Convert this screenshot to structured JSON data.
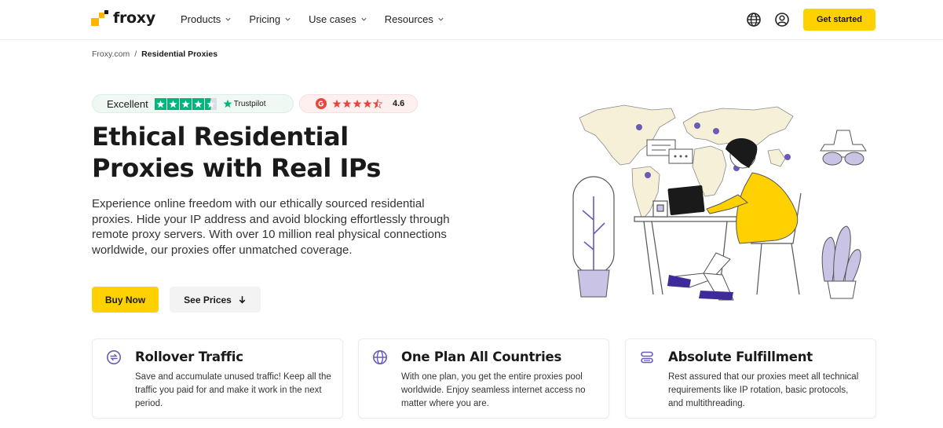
{
  "header": {
    "logo_text": "froxy",
    "nav": [
      {
        "label": "Products"
      },
      {
        "label": "Pricing"
      },
      {
        "label": "Use cases"
      },
      {
        "label": "Resources"
      }
    ],
    "cta_label": "Get started",
    "icons": [
      "globe-icon",
      "user-icon"
    ]
  },
  "breadcrumb": {
    "home": "Froxy.com",
    "separator": "/",
    "current": "Residential Proxies"
  },
  "ratings": {
    "trustpilot": {
      "label": "Excellent",
      "brand": "Trustpilot",
      "stars": 4.5
    },
    "google": {
      "rating": "4.6",
      "stars": 4.5
    }
  },
  "hero": {
    "title_line1": "Ethical Residential",
    "title_line2": "Proxies with Real IPs",
    "description": "Experience online freedom with our ethically sourced residential proxies. Hide your IP address and avoid blocking effortlessly through remote proxy servers. With over 10 million real physical connections worldwide, our proxies offer unmatched coverage.",
    "buy_label": "Buy Now",
    "prices_label": "See Prices"
  },
  "features": [
    {
      "icon": "rollover-icon",
      "title": "Rollover Traffic",
      "text": "Save and accumulate unused traffic! Keep all the traffic you paid for and make it work in the next period."
    },
    {
      "icon": "globe-icon",
      "title": "One Plan All Countries",
      "text": "With one plan, you get the entire proxies pool worldwide. Enjoy seamless internet access no matter where you are."
    },
    {
      "icon": "stack-icon",
      "title": "Absolute Fulfillment",
      "text": "Rest assured that our proxies meet all technical requirements like IP rotation, basic protocols, and multithreading."
    }
  ],
  "colors": {
    "accent_yellow": "#ffd100",
    "accent_purple": "#6b5bb5",
    "trustpilot_green": "#00b67a",
    "google_red": "#e8453c",
    "map_beige": "#f6f0d8"
  }
}
